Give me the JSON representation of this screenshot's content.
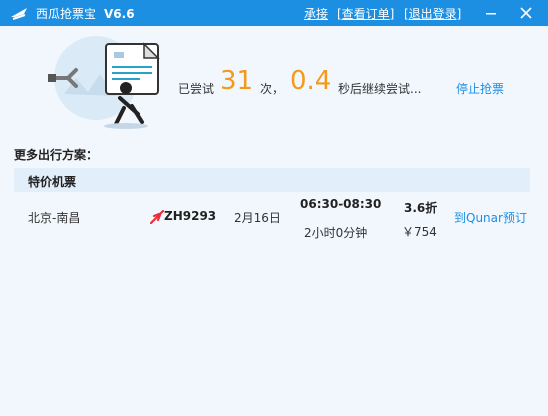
{
  "app": {
    "title": "西瓜抢票宝",
    "version": "V6.6",
    "nav": [
      "承接",
      "[查看订单]",
      "[退出登录]"
    ]
  },
  "status": {
    "tried_prefix": "已尝试",
    "tried_count": "31",
    "tried_unit": "次，",
    "next_seconds": "0.4",
    "next_suffix": "秒后继续尝试...",
    "stop_label": "停止抢票"
  },
  "alternatives": {
    "section_title": "更多出行方案：",
    "category": "特价机票",
    "flight": {
      "route": "北京-南昌",
      "flight_no": "ZH9293",
      "date": "2月16日",
      "time": "06:30-08:30",
      "duration": "2小时0分钟",
      "discount": "3.6折",
      "price": "￥754",
      "book_label": "到Qunar预订"
    }
  },
  "colors": {
    "accent": "#1c8fe3",
    "highlight": "#f39a1e",
    "background": "#f2f7fd"
  },
  "icons": [
    "app-logo-icon",
    "minimize-icon",
    "close-icon",
    "ticket-illustration",
    "plane-icon"
  ]
}
